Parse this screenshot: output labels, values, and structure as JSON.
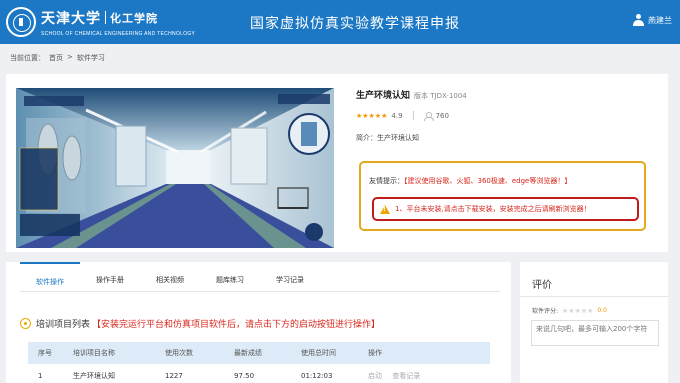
{
  "header": {
    "logo_name": "天津大学",
    "logo_dept": "化工学院",
    "logo_subtitle": "SCHOOL OF CHEMICAL ENGINEERING AND TECHNOLOGY",
    "title": "国家虚拟仿真实验教学课程申报",
    "user_name": "燕建兰",
    "brand_color": "#1c78c5"
  },
  "breadcrumb": {
    "prefix": "当前位置：",
    "home": "首页",
    "sep": ">",
    "current": "软件学习"
  },
  "software": {
    "name": "生产环境认知",
    "version": "版本 TJDX-1004",
    "stars": "★★★★★",
    "rating": "4.9",
    "views": "760",
    "intro": "简介：生产环境认知"
  },
  "tips": {
    "label": "友情提示：",
    "browser": "【建议使用谷歌、火狐、360极速、edge等浏览器！】",
    "warning": "1、平台未安装,请点击下载安装，安装完成之后请刷新浏览器！"
  },
  "tabs": [
    {
      "label": "软件操作"
    },
    {
      "label": "操作手册"
    },
    {
      "label": "相关视频"
    },
    {
      "label": "题库练习"
    },
    {
      "label": "学习记录"
    }
  ],
  "training": {
    "title": "培训项目列表",
    "note": "【安装完运行平台和仿真项目软件后，请点击下方的启动按钮进行操作】",
    "headers": [
      "序号",
      "培训项目名称",
      "使用次数",
      "最新成绩",
      "使用总时间",
      "操作"
    ],
    "rows": [
      {
        "index": "1",
        "name": "生产环境认知",
        "count": "1227",
        "score": "97.50",
        "time": "01:12:03",
        "action_start": "启动",
        "action_view": "查看记录"
      }
    ]
  },
  "review": {
    "title": "评价",
    "rating_label": "软件评分:",
    "stars": "★★★★★",
    "rating_value": "0.0",
    "placeholder": "来说几句吧，最多可输入200个字符"
  }
}
